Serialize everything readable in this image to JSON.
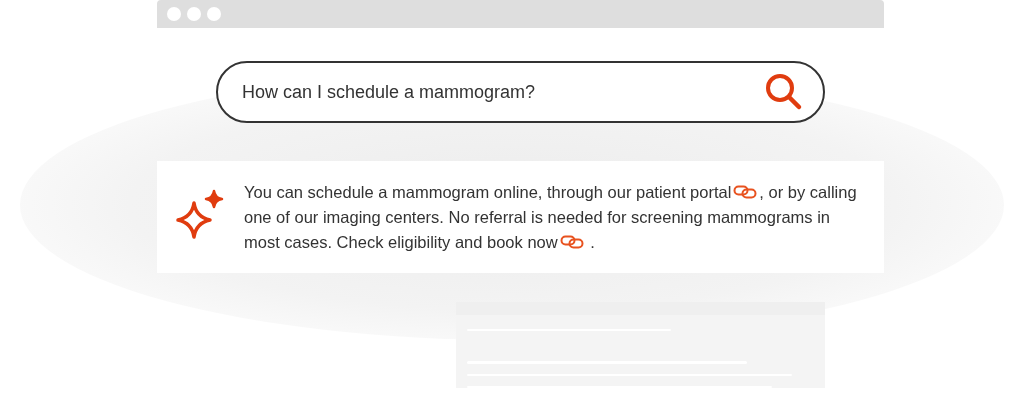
{
  "search": {
    "value": "How can I schedule a mammogram?"
  },
  "answer": {
    "parts": [
      {
        "kind": "text",
        "text": "You can schedule a mammogram online, through our patient portal"
      },
      {
        "kind": "link"
      },
      {
        "kind": "text",
        "text": ", or by calling one of our imaging centers. No referral is needed for screening mammograms in most cases. Check eligibility and book now"
      },
      {
        "kind": "link"
      },
      {
        "kind": "text",
        "text": " ."
      }
    ]
  }
}
